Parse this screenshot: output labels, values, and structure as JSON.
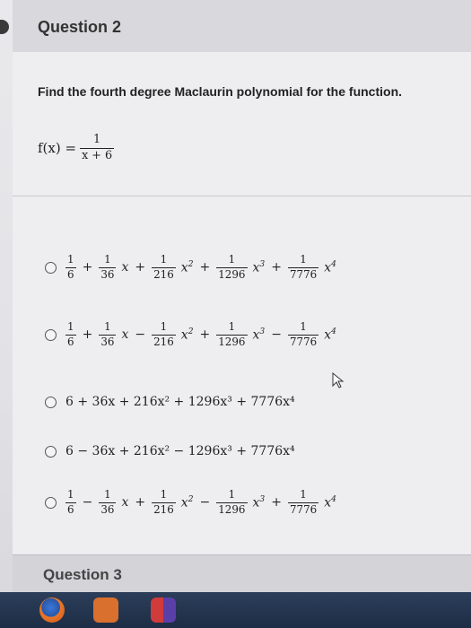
{
  "question": {
    "title": "Question 2",
    "prompt": "Find the fourth degree Maclaurin polynomial for the function.",
    "function": {
      "lhs": "f(x) =",
      "numerator": "1",
      "denominator": "x + 6"
    }
  },
  "options": [
    {
      "terms": [
        {
          "sign": "",
          "num": "1",
          "den": "6",
          "x": ""
        },
        {
          "sign": "+",
          "num": "1",
          "den": "36",
          "x": "x"
        },
        {
          "sign": "+",
          "num": "1",
          "den": "216",
          "x": "x",
          "pow": "2"
        },
        {
          "sign": "+",
          "num": "1",
          "den": "1296",
          "x": "x",
          "pow": "3"
        },
        {
          "sign": "+",
          "num": "1",
          "den": "7776",
          "x": "x",
          "pow": "4"
        }
      ]
    },
    {
      "terms": [
        {
          "sign": "",
          "num": "1",
          "den": "6",
          "x": ""
        },
        {
          "sign": "+",
          "num": "1",
          "den": "36",
          "x": "x"
        },
        {
          "sign": "−",
          "num": "1",
          "den": "216",
          "x": "x",
          "pow": "2"
        },
        {
          "sign": "+",
          "num": "1",
          "den": "1296",
          "x": "x",
          "pow": "3"
        },
        {
          "sign": "−",
          "num": "1",
          "den": "7776",
          "x": "x",
          "pow": "4"
        }
      ]
    },
    {
      "text": "6 + 36x + 216x² + 1296x³ + 7776x⁴"
    },
    {
      "text": "6 − 36x + 216x² − 1296x³ + 7776x⁴"
    },
    {
      "terms": [
        {
          "sign": "",
          "num": "1",
          "den": "6",
          "x": ""
        },
        {
          "sign": "−",
          "num": "1",
          "den": "36",
          "x": "x"
        },
        {
          "sign": "+",
          "num": "1",
          "den": "216",
          "x": "x",
          "pow": "2"
        },
        {
          "sign": "−",
          "num": "1",
          "den": "1296",
          "x": "x",
          "pow": "3"
        },
        {
          "sign": "+",
          "num": "1",
          "den": "7776",
          "x": "x",
          "pow": "4"
        }
      ]
    }
  ],
  "next_question": {
    "title": "Question 3"
  },
  "colors": {
    "taskbar": "#1d2d45",
    "accent": "#e8a23c"
  },
  "icons": [
    "mouse-pointer-icon",
    "firefox-icon",
    "files-icon",
    "windows-icon"
  ]
}
